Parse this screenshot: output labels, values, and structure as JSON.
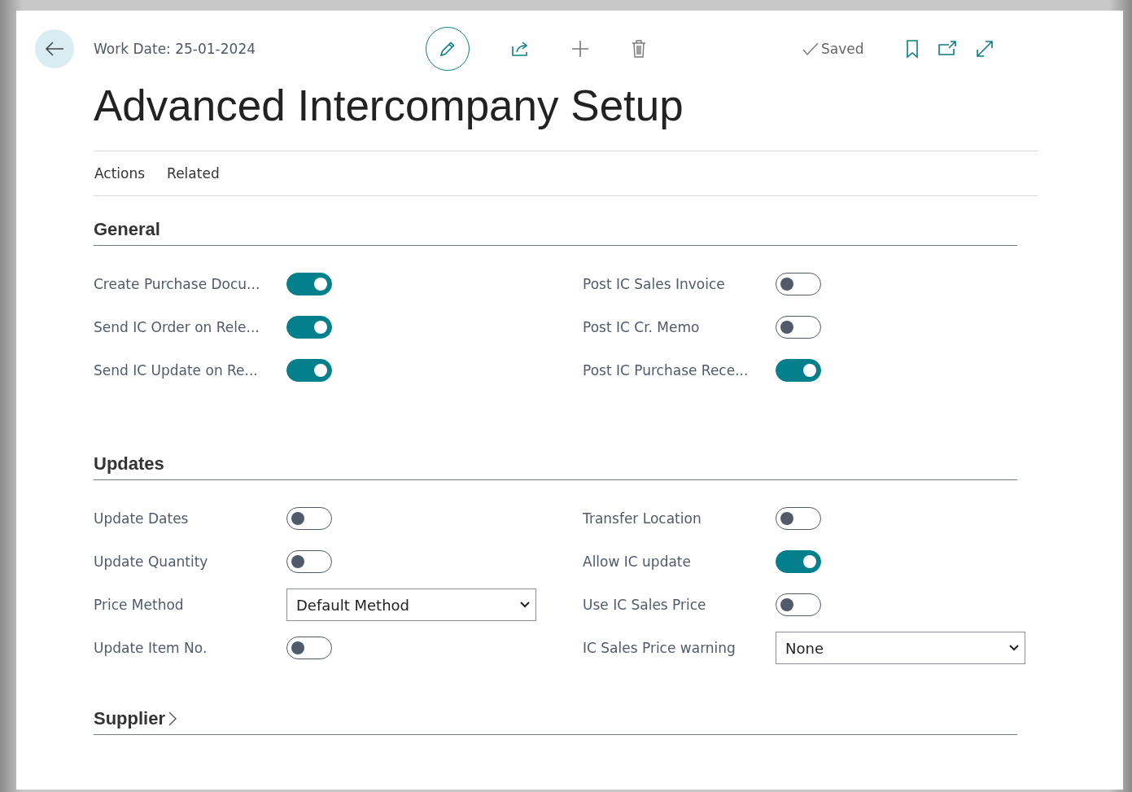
{
  "header": {
    "work_date": "Work Date: 25-01-2024",
    "saved": "Saved"
  },
  "title": "Advanced Intercompany Setup",
  "menu": [
    "Actions",
    "Related"
  ],
  "sections": [
    {
      "title": "General",
      "expanded": true,
      "left": [
        {
          "kind": "toggle",
          "label": "Create Purchase Docu...",
          "on": true
        },
        {
          "kind": "toggle",
          "label": "Send IC Order on Rele...",
          "on": true
        },
        {
          "kind": "toggle",
          "label": "Send IC Update on Re...",
          "on": true
        }
      ],
      "right": [
        {
          "kind": "toggle",
          "label": "Post IC Sales Invoice",
          "on": false
        },
        {
          "kind": "toggle",
          "label": "Post IC Cr. Memo",
          "on": false
        },
        {
          "kind": "toggle",
          "label": "Post IC Purchase Rece...",
          "on": true
        }
      ]
    },
    {
      "title": "Updates",
      "expanded": true,
      "left": [
        {
          "kind": "toggle",
          "label": "Update Dates",
          "on": false
        },
        {
          "kind": "toggle",
          "label": "Update Quantity",
          "on": false
        },
        {
          "kind": "select",
          "label": "Price Method",
          "value": "Default Method"
        },
        {
          "kind": "toggle",
          "label": "Update Item No.",
          "on": false
        }
      ],
      "right": [
        {
          "kind": "toggle",
          "label": "Transfer Location",
          "on": false
        },
        {
          "kind": "toggle",
          "label": "Allow IC update",
          "on": true
        },
        {
          "kind": "toggle",
          "label": "Use IC Sales Price",
          "on": false
        },
        {
          "kind": "select",
          "label": "IC Sales Price warning",
          "value": "None"
        }
      ]
    },
    {
      "title": "Supplier",
      "expanded": false
    }
  ]
}
